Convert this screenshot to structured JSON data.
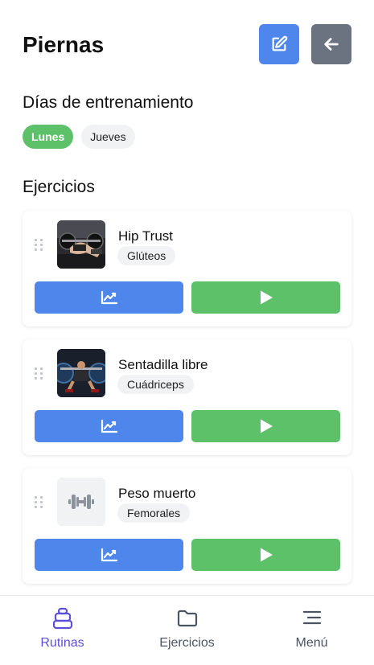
{
  "header": {
    "title": "Piernas",
    "edit_icon": "edit-icon",
    "back_icon": "arrow-left-icon"
  },
  "days": {
    "title": "Días de entrenamiento",
    "items": [
      {
        "label": "Lunes",
        "active": true
      },
      {
        "label": "Jueves",
        "active": false
      }
    ]
  },
  "exercises": {
    "title": "Ejercicios",
    "items": [
      {
        "name": "Hip Trust",
        "muscle": "Glúteos",
        "image": "hip-thrust-photo"
      },
      {
        "name": "Sentadilla libre",
        "muscle": "Cuádriceps",
        "image": "squat-photo"
      },
      {
        "name": "Peso muerto",
        "muscle": "Femorales",
        "image": "dumbbell-placeholder-icon"
      }
    ],
    "stats_icon": "chart-line-icon",
    "play_icon": "play-icon"
  },
  "nav": {
    "items": [
      {
        "label": "Rutinas",
        "icon": "dumbbell-weight-icon",
        "active": true
      },
      {
        "label": "Ejercicios",
        "icon": "folder-icon",
        "active": false
      },
      {
        "label": "Menú",
        "icon": "menu-icon",
        "active": false
      }
    ]
  },
  "colors": {
    "primary_blue": "#4f86ec",
    "success_green": "#5cc168",
    "back_gray": "#6b7280",
    "nav_active": "#5b4fd9",
    "chip_bg": "#f1f2f4"
  }
}
